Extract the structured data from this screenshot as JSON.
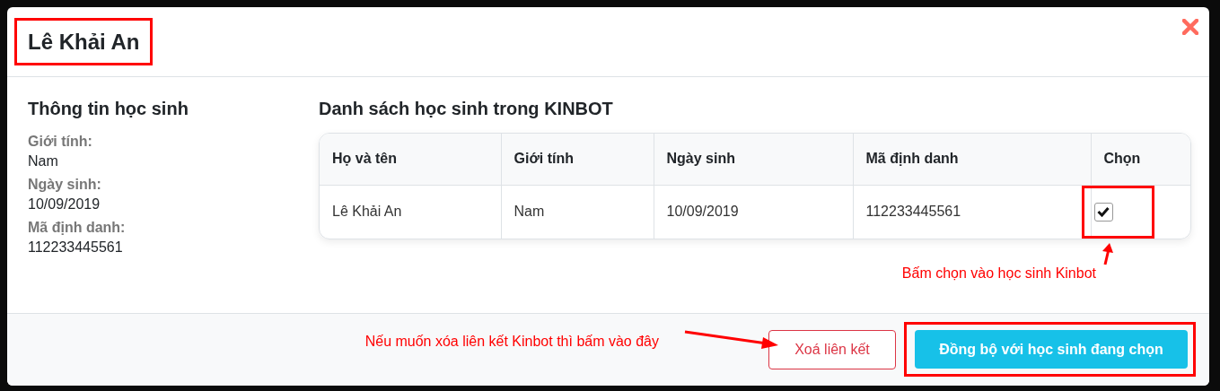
{
  "modal": {
    "title": "Lê Khải An"
  },
  "info": {
    "heading": "Thông tin học sinh",
    "fields": [
      {
        "label": "Giới tính:",
        "value": "Nam"
      },
      {
        "label": "Ngày sinh:",
        "value": "10/09/2019"
      },
      {
        "label": "Mã định danh:",
        "value": "112233445561"
      }
    ]
  },
  "list": {
    "heading": "Danh sách học sinh trong KINBOT",
    "columns": [
      "Họ và tên",
      "Giới tính",
      "Ngày sinh",
      "Mã định danh",
      "Chọn"
    ],
    "rows": [
      {
        "cells": [
          "Lê Khải An",
          "Nam",
          "10/09/2019",
          "112233445561"
        ],
        "checked": true
      }
    ]
  },
  "annotations": [
    "Bấm chọn vào học sinh Kinbot",
    "Nếu muốn xóa liên kết Kinbot thì bấm vào đây"
  ],
  "buttons": [
    {
      "label": "Xoá liên kết",
      "kind": "outline-danger"
    },
    {
      "label": "Đồng bộ với học sinh đang chọn",
      "kind": "info"
    }
  ]
}
